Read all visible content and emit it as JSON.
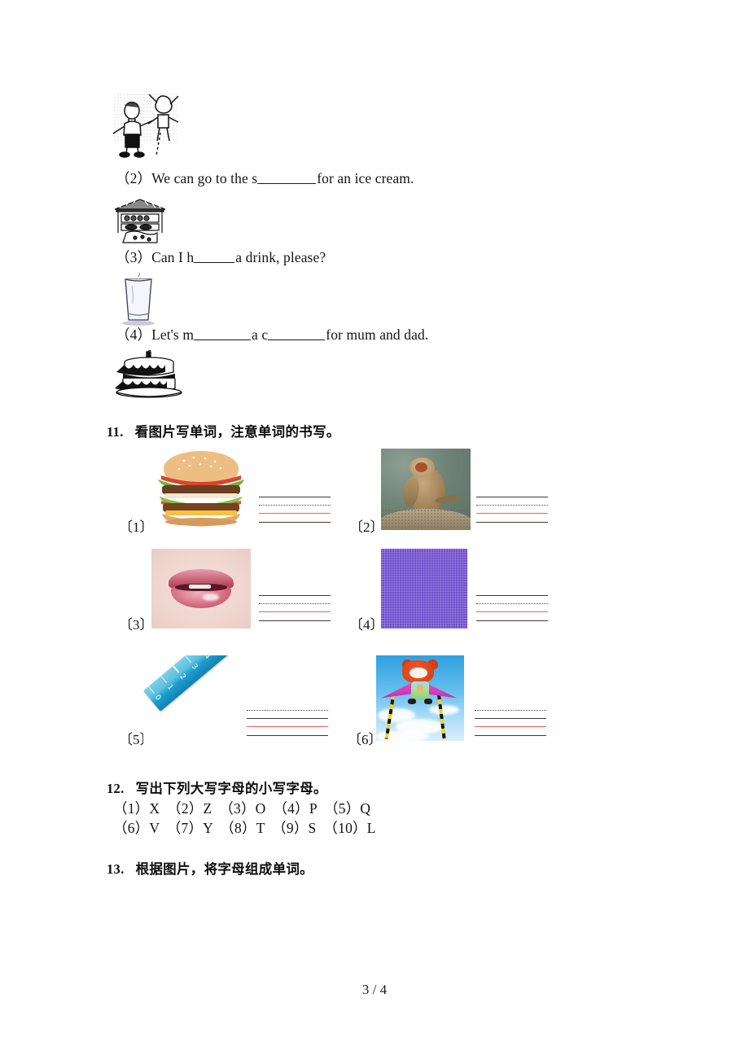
{
  "document": {
    "footer": "3 / 4"
  },
  "fill_in_blanks": {
    "items": [
      {
        "marker": "（2）",
        "text_before": "We can go to the s",
        "blank_width": 72,
        "text_after": "for an ice cream.",
        "image_alt": "boy-with-puppet-sketch"
      },
      {
        "marker": "（3）",
        "text_before": "Can I h",
        "blank_width": 50,
        "text_after": "a drink, please?",
        "image_alt": "shop-stall-sketch"
      },
      {
        "marker": "（4）",
        "text_before": "Let's m",
        "blank_width": 70,
        "text_mid": "a c",
        "blank2_width": 70,
        "text_after": "for mum and dad.",
        "image_alt": "glass-of-water-sketch"
      }
    ],
    "trailing_image_alt": "birthday-cake-sketch"
  },
  "exercise_11": {
    "number": "11.",
    "title": "看图片写单词，注意单词的书写。",
    "items": [
      {
        "label": "〔1〕",
        "image_alt": "hamburger-photo"
      },
      {
        "label": "〔2〕",
        "image_alt": "monkey-photo"
      },
      {
        "label": "〔3〕",
        "image_alt": "lips-mouth-photo"
      },
      {
        "label": "〔4〕",
        "image_alt": "purple-color-swatch"
      },
      {
        "label": "〔5〕",
        "image_alt": "blue-ruler-photo"
      },
      {
        "label": "〔6〕",
        "image_alt": "kite-in-sky-photo"
      }
    ],
    "guide_line_colors": {
      "line1": "#3a3a3a",
      "line2": "#4a4a4a",
      "line3": "#f2605f",
      "line4": "#3a3a3a"
    }
  },
  "exercise_12": {
    "number": "12.",
    "title": "写出下列大写字母的小写字母。",
    "row1": "（1）X　（2）Z　（3）O　（4）P　（5）Q",
    "row2": "（6）V　（7）Y　（8）T　（9）S　（10）L",
    "letters": [
      {
        "n": "（1）",
        "letter": "X"
      },
      {
        "n": "（2）",
        "letter": "Z"
      },
      {
        "n": "（3）",
        "letter": "O"
      },
      {
        "n": "（4）",
        "letter": "P"
      },
      {
        "n": "（5）",
        "letter": "Q"
      },
      {
        "n": "（6）",
        "letter": "V"
      },
      {
        "n": "（7）",
        "letter": "Y"
      },
      {
        "n": "（8）",
        "letter": "T"
      },
      {
        "n": "（9）",
        "letter": "S"
      },
      {
        "n": "（10）",
        "letter": "L"
      }
    ]
  },
  "exercise_13": {
    "number": "13.",
    "title": "根据图片，将字母组成单词。"
  }
}
